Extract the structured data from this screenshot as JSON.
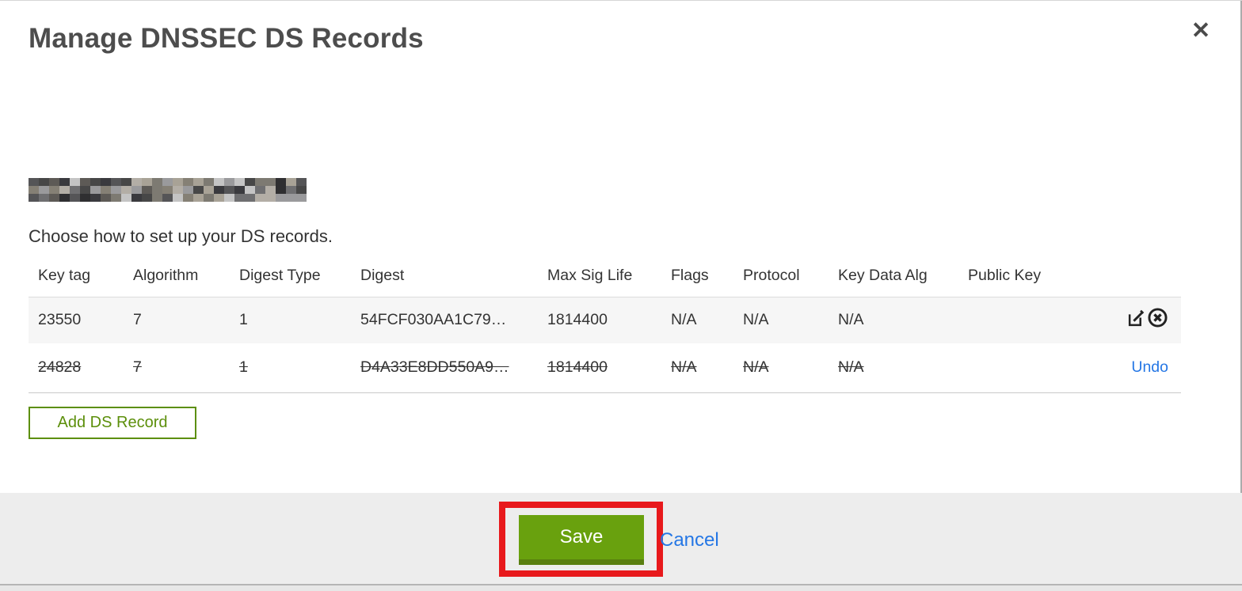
{
  "modal": {
    "title": "Manage DNSSEC DS Records",
    "close_icon": "✕",
    "instruction": "Choose how to set up your DS records."
  },
  "table": {
    "headers": {
      "key_tag": "Key tag",
      "algorithm": "Algorithm",
      "digest_type": "Digest Type",
      "digest": "Digest",
      "max_sig_life": "Max Sig Life",
      "flags": "Flags",
      "protocol": "Protocol",
      "key_data_alg": "Key Data Alg",
      "public_key": "Public Key"
    },
    "rows": [
      {
        "key_tag": "23550",
        "algorithm": "7",
        "digest_type": "1",
        "digest": "54FCF030AA1C79…",
        "max_sig_life": "1814400",
        "flags": "N/A",
        "protocol": "N/A",
        "key_data_alg": "N/A",
        "public_key": "",
        "state": "active",
        "actions": [
          "edit-icon",
          "delete-icon"
        ]
      },
      {
        "key_tag": "24828",
        "algorithm": "7",
        "digest_type": "1",
        "digest": "D4A33E8DD550A9…",
        "max_sig_life": "1814400",
        "flags": "N/A",
        "protocol": "N/A",
        "key_data_alg": "N/A",
        "public_key": "",
        "state": "deleted",
        "undo_label": "Undo"
      }
    ]
  },
  "buttons": {
    "add_ds_record": "Add DS Record",
    "save": "Save",
    "cancel": "Cancel"
  },
  "annotation": {
    "type": "red-highlight-rectangle",
    "target": "save-button",
    "color": "#e8191c"
  },
  "colors": {
    "green": "#69a10e",
    "green_dark": "#597f10",
    "green_outline": "#5c8f0b",
    "link_blue": "#2577e5",
    "row_highlight": "#f6f6f6",
    "footer_gray": "#ededed"
  }
}
